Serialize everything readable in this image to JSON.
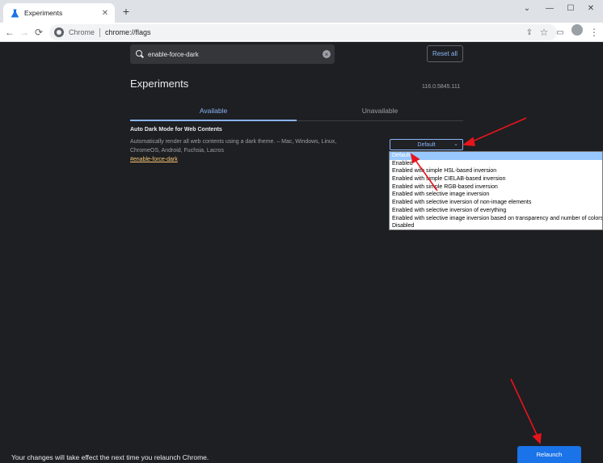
{
  "browser": {
    "tab_title": "Experiments",
    "tab_close": "✕",
    "new_tab": "+",
    "window_controls": [
      "⌄",
      "—",
      "☐",
      "✕"
    ],
    "omnibox_prefix": "Chrome",
    "url": "chrome://flags",
    "nav": [
      "←",
      "→",
      "⟳"
    ],
    "toolbar_icons": [
      "share-icon",
      "star-icon",
      "tab-search-icon",
      "profile-icon",
      "menu-icon"
    ],
    "toolbar_glyphs": [
      "⇪",
      "☆",
      "▭",
      "⋮"
    ]
  },
  "search": {
    "value": "enable-force-dark",
    "clear": "×"
  },
  "header": {
    "reset_label": "Reset all",
    "title": "Experiments",
    "version": "116.0.5845.111"
  },
  "tabs": [
    {
      "label": "Available",
      "active": true
    },
    {
      "label": "Unavailable",
      "active": false
    }
  ],
  "flag": {
    "title": "Auto Dark Mode for Web Contents",
    "description": "Automatically render all web contents using a dark theme. – Mac, Windows, Linux, ChromeOS, Android, Fuchsia, Lacros",
    "link": "#enable-force-dark",
    "selected": "Default",
    "chevron": "⌄",
    "options": [
      "Default",
      "Enabled",
      "Enabled with simple HSL-based inversion",
      "Enabled with simple CIELAB-based inversion",
      "Enabled with simple RGB-based inversion",
      "Enabled with selective image inversion",
      "Enabled with selective inversion of non-image elements",
      "Enabled with selective inversion of everything",
      "Enabled with selective image inversion based on transparency and number of colors",
      "Disabled"
    ]
  },
  "footer": {
    "message": "Your changes will take effect the next time you relaunch Chrome.",
    "relaunch_label": "Relaunch"
  },
  "colors": {
    "background": "#1e1f22",
    "accent": "#8ab4f8",
    "button": "#1a73e8",
    "annotation": "#e8141c",
    "link": "#f8c876",
    "option_highlight": "#99c8ff"
  }
}
